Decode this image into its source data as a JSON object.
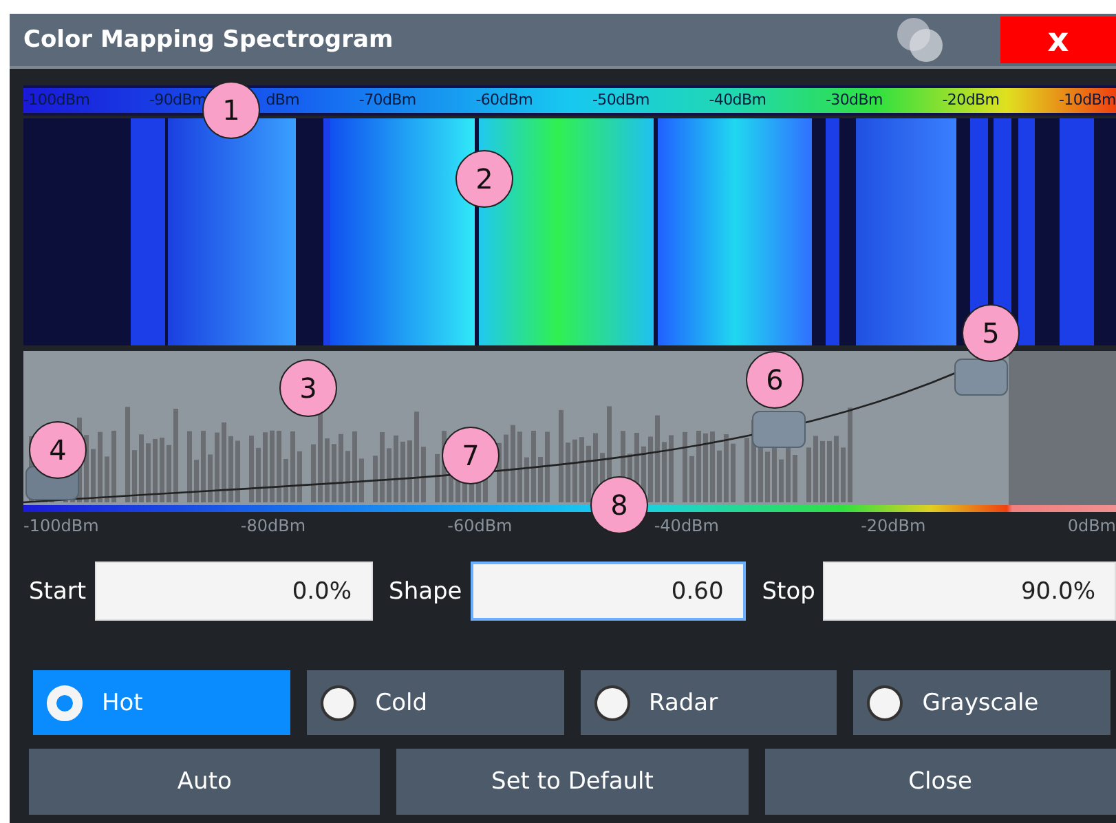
{
  "window": {
    "title": "Color Mapping Spectrogram",
    "close_glyph": "x"
  },
  "color_scale": {
    "labels": [
      "-100dBm",
      "-90dBm",
      "dBm",
      "-70dBm",
      "-60dBm",
      "-50dBm",
      "-40dBm",
      "-30dBm",
      "-20dBm",
      "-10dBm"
    ]
  },
  "histogram_axis": {
    "labels": [
      "-100dBm",
      "-80dBm",
      "-60dBm",
      "-40dBm",
      "-20dBm",
      "0dBm"
    ]
  },
  "fields": [
    {
      "label": "Start",
      "value": "0.0%",
      "focused": false
    },
    {
      "label": "Shape",
      "value": "0.60",
      "focused": true
    },
    {
      "label": "Stop",
      "value": "90.0%",
      "focused": false
    }
  ],
  "color_schemes": [
    {
      "label": "Hot",
      "selected": true
    },
    {
      "label": "Cold",
      "selected": false
    },
    {
      "label": "Radar",
      "selected": false
    },
    {
      "label": "Grayscale",
      "selected": false
    }
  ],
  "buttons": [
    "Auto",
    "Set to Default",
    "Close"
  ],
  "callouts": [
    "1",
    "2",
    "3",
    "4",
    "5",
    "6",
    "7",
    "8"
  ]
}
